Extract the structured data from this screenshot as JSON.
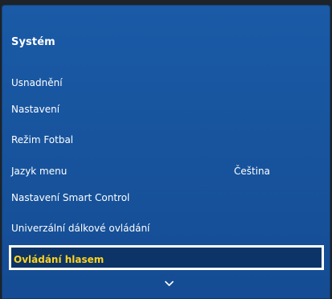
{
  "panel": {
    "title": "Systém"
  },
  "menu": {
    "items": [
      {
        "label": "Usnadnění",
        "value": ""
      },
      {
        "label": "Nastavení",
        "value": ""
      },
      {
        "label": "Režim Fotbal",
        "value": ""
      },
      {
        "label": "Jazyk menu",
        "value": "Čeština"
      },
      {
        "label": "Nastavení Smart Control",
        "value": ""
      },
      {
        "label": "Univerzální dálkové ovládání",
        "value": ""
      },
      {
        "label": "Ovládání hlasem",
        "value": "",
        "selected": true
      }
    ]
  },
  "icons": {
    "scroll_down": "chevron-down-icon"
  },
  "colors": {
    "panel_background": "#17539c",
    "selected_text": "#ffd21f",
    "selected_background": "#0c3466",
    "selection_border": "#ffffff",
    "text": "#ffffff"
  }
}
